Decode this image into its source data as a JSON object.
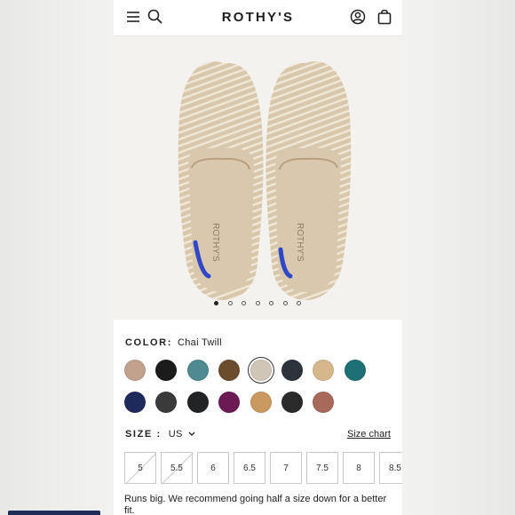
{
  "header": {
    "logo": "ROTHY'S",
    "icons": [
      "menu-icon",
      "search-icon",
      "account-icon",
      "bag-icon"
    ]
  },
  "gallery": {
    "image": "product-photo",
    "slide_count": 7,
    "active_slide": 1
  },
  "color": {
    "label": "COLOR:",
    "value": "Chai Twill",
    "swatches": [
      {
        "name": "swatch-rose-twill",
        "fill": "#c2a18c"
      },
      {
        "name": "swatch-black-tweed",
        "fill": "#1b1b1b"
      },
      {
        "name": "swatch-teal",
        "fill": "#4f8a90"
      },
      {
        "name": "swatch-leopard",
        "fill": "#6b4c2d"
      },
      {
        "name": "swatch-chai-twill",
        "fill": "#cfc6b7",
        "selected": true
      },
      {
        "name": "swatch-charcoal",
        "fill": "#2c333b"
      },
      {
        "name": "swatch-tan-stripe",
        "fill": "#d6b78c"
      },
      {
        "name": "swatch-ocean-pattern",
        "fill": "#1c6f75"
      },
      {
        "name": "swatch-navy",
        "fill": "#1f2a5c"
      },
      {
        "name": "swatch-black-white-tweed",
        "fill": "#3a3a3a"
      },
      {
        "name": "swatch-black",
        "fill": "#222324"
      },
      {
        "name": "swatch-plum",
        "fill": "#6b1a53"
      },
      {
        "name": "swatch-camel",
        "fill": "#c9995f"
      },
      {
        "name": "swatch-black-floral",
        "fill": "#2a2a2a"
      },
      {
        "name": "swatch-terracotta",
        "fill": "#a8685a"
      }
    ]
  },
  "size": {
    "label": "SIZE :",
    "unit": "US",
    "chart_link": "Size chart",
    "options": [
      {
        "label": "5",
        "available": false
      },
      {
        "label": "5.5",
        "available": false
      },
      {
        "label": "6",
        "available": true
      },
      {
        "label": "6.5",
        "available": true
      },
      {
        "label": "7",
        "available": true
      },
      {
        "label": "7.5",
        "available": true
      },
      {
        "label": "8",
        "available": true
      },
      {
        "label": "8.5",
        "available": true
      }
    ]
  },
  "note": "Runs big. We recommend going half a size down for a better fit."
}
